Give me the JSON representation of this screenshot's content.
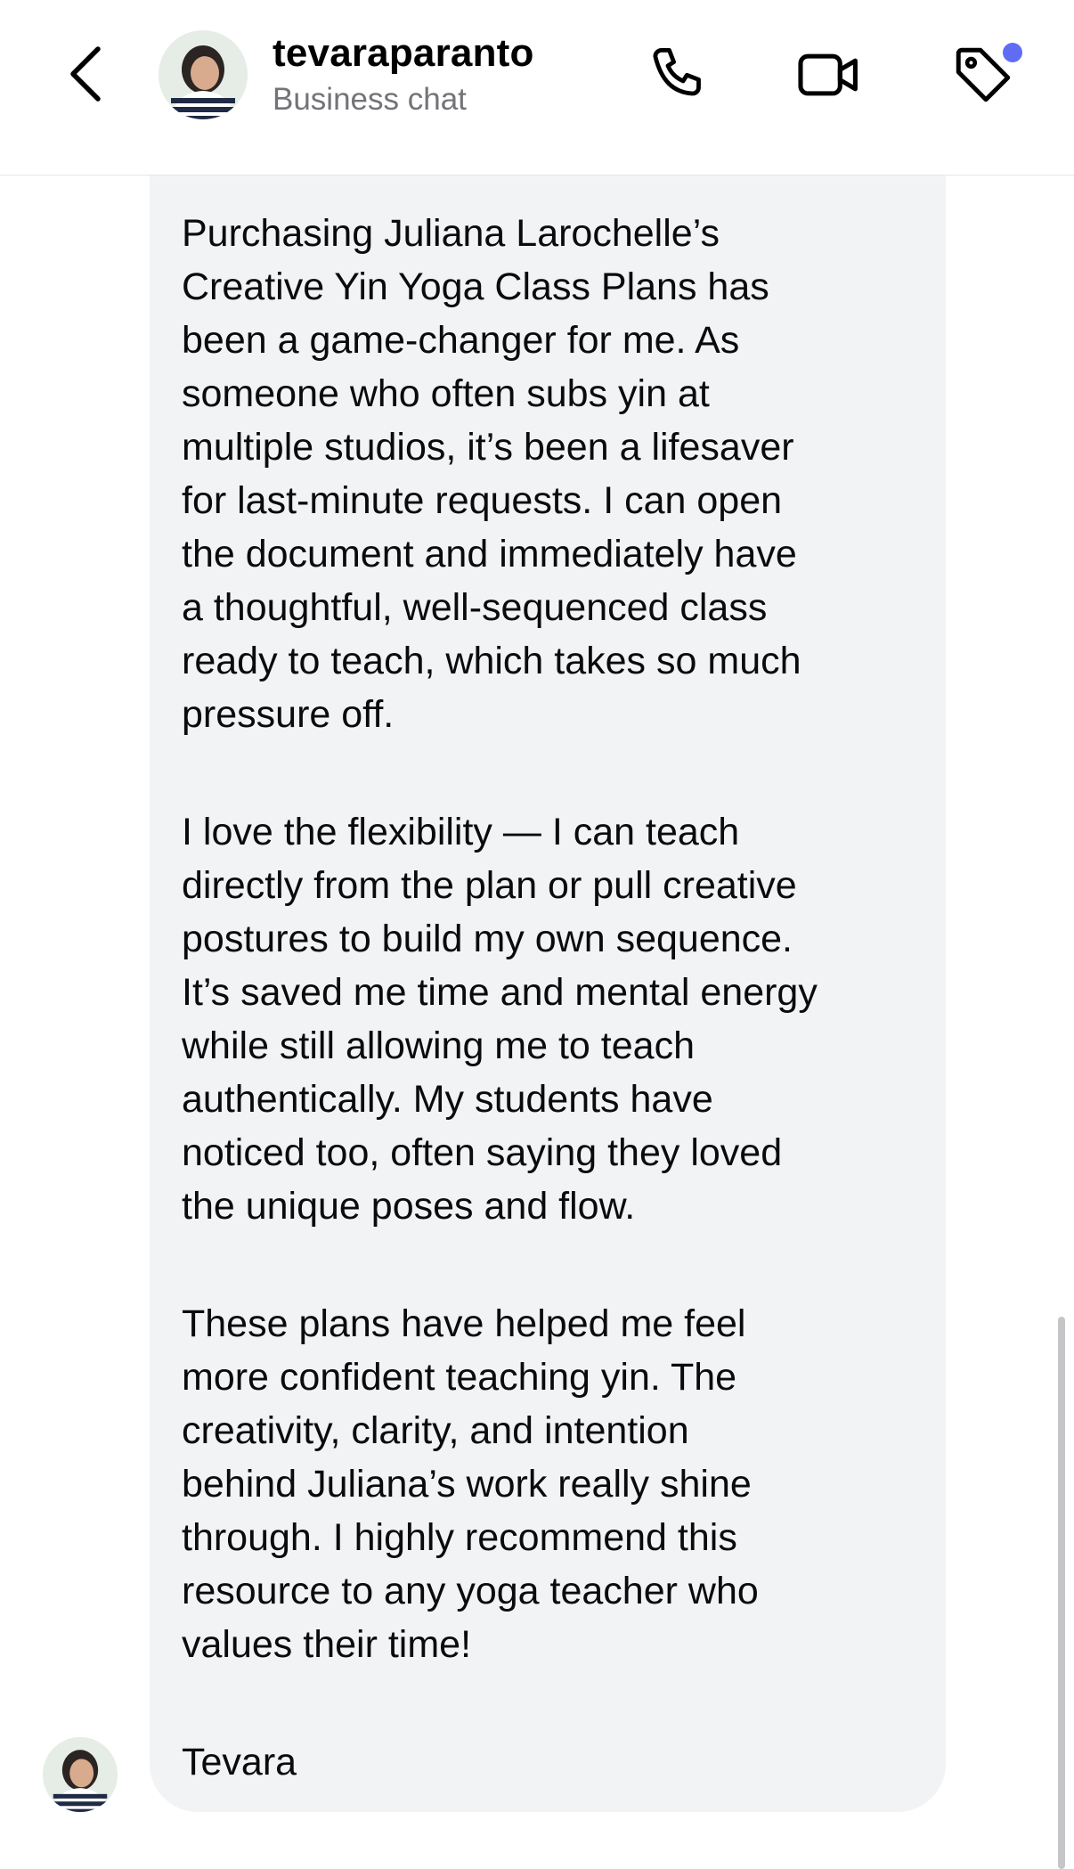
{
  "header": {
    "username": "tevaraparanto",
    "subtitle": "Business chat",
    "icons": {
      "back": "chevron-left-icon",
      "call": "phone-icon",
      "video": "video-camera-icon",
      "label": "tag-icon"
    },
    "badge_color": "#5f6cf3"
  },
  "message": {
    "paragraphs": [
      "Purchasing Juliana Larochelle’s\nCreative Yin Yoga Class Plans has\nbeen a game-changer for me. As\nsomeone who often subs yin at\nmultiple studios, it’s been a lifesaver\nfor last-minute requests. I can open\nthe document and immediately have\na thoughtful, well-sequenced class\nready to teach, which takes so much\npressure off.",
      "I love the flexibility — I can teach\ndirectly from the plan or pull creative\npostures to build my own sequence.\nIt’s saved me time and mental energy\nwhile still allowing me to teach\nauthentically. My students have\nnoticed too, often saying they loved\nthe unique poses and flow.",
      "These plans have helped me feel\nmore confident teaching yin. The\ncreativity, clarity, and intention\nbehind Juliana’s work really shine\nthrough. I highly recommend this\nresource to any yoga teacher who\nvalues their time!",
      "Tevara"
    ],
    "bubble_color": "#f2f3f5"
  }
}
